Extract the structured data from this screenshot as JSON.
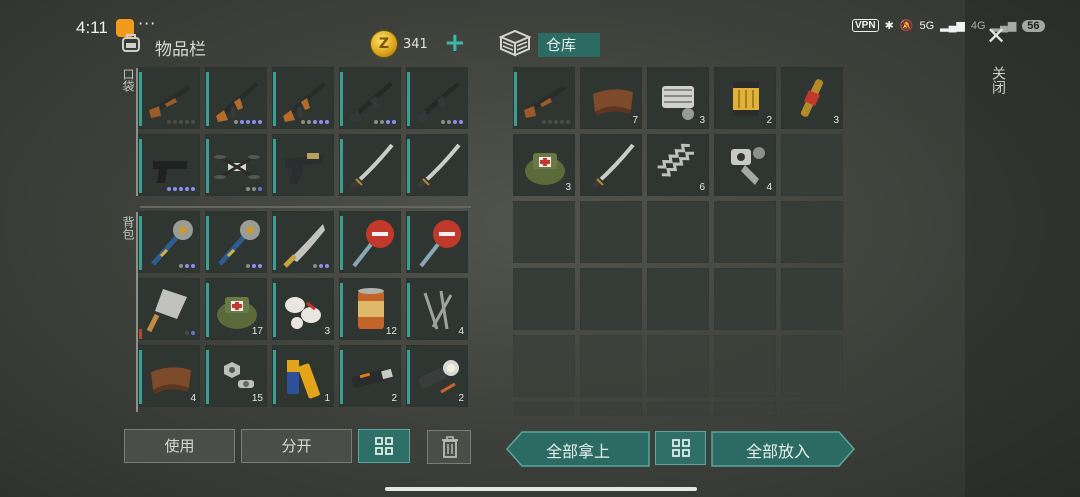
{
  "status_bar": {
    "time": "4:11",
    "dots": "···",
    "vpn": "VPN",
    "net1": "5G",
    "net2": "4G",
    "battery": "56"
  },
  "inventory": {
    "title": "物品栏",
    "coins": "341",
    "add": "+",
    "pocket_label": "口袋",
    "backpack_label": "背包"
  },
  "warehouse": {
    "title": "仓库"
  },
  "close": {
    "x": "✕",
    "label": "关闭"
  },
  "inventory_slots": [
    {
      "id": "inv-0",
      "item": "shotgun-icon",
      "qty": "",
      "dots": [
        "d",
        "d",
        "d",
        "d",
        "d"
      ]
    },
    {
      "id": "inv-1",
      "item": "ak-rifle-icon",
      "qty": "",
      "dots": [
        "g",
        "p",
        "p",
        "p",
        "p"
      ]
    },
    {
      "id": "inv-2",
      "item": "ak-rifle-icon",
      "qty": "",
      "dots": [
        "g",
        "g",
        "p",
        "p",
        "p"
      ]
    },
    {
      "id": "inv-3",
      "item": "assault-rifle-icon",
      "qty": "",
      "dots": [
        "g",
        "g",
        "p",
        "p"
      ]
    },
    {
      "id": "inv-4",
      "item": "assault-rifle-icon",
      "qty": "",
      "dots": [
        "g",
        "g",
        "p",
        "p"
      ]
    },
    {
      "id": "inv-5",
      "item": "pistol-icon",
      "qty": "",
      "dots": [
        "p",
        "p",
        "p",
        "p",
        "p"
      ]
    },
    {
      "id": "inv-6",
      "item": "drone-icon",
      "qty": "",
      "dots": [
        "g",
        "g",
        "b"
      ]
    },
    {
      "id": "inv-7",
      "item": "revolver-icon",
      "qty": "",
      "dots": []
    },
    {
      "id": "inv-8",
      "item": "katana-icon",
      "qty": "",
      "dots": []
    },
    {
      "id": "inv-9",
      "item": "katana-icon",
      "qty": "",
      "dots": []
    },
    {
      "id": "inv-10",
      "item": "spiked-club-icon",
      "qty": "",
      "dots": [
        "g",
        "p",
        "p"
      ]
    },
    {
      "id": "inv-11",
      "item": "spiked-club-icon",
      "qty": "",
      "dots": [
        "g",
        "p",
        "p"
      ]
    },
    {
      "id": "inv-12",
      "item": "machete-icon",
      "qty": "",
      "dots": [
        "g",
        "p",
        "p"
      ]
    },
    {
      "id": "inv-13",
      "item": "stop-sign-icon",
      "qty": "",
      "dots": []
    },
    {
      "id": "inv-14",
      "item": "stop-sign-icon",
      "qty": "",
      "dots": []
    },
    {
      "id": "inv-15",
      "item": "cleaver-icon",
      "qty": "",
      "dots": [
        "d",
        "b"
      ]
    },
    {
      "id": "inv-16",
      "item": "medkit-bag-icon",
      "qty": "17",
      "dots": []
    },
    {
      "id": "inv-17",
      "item": "bandage-icon",
      "qty": "3",
      "dots": []
    },
    {
      "id": "inv-18",
      "item": "food-can-icon",
      "qty": "12",
      "dots": []
    },
    {
      "id": "inv-19",
      "item": "nails-icon",
      "qty": "4",
      "dots": []
    },
    {
      "id": "inv-20",
      "item": "leather-icon",
      "qty": "4",
      "dots": []
    },
    {
      "id": "inv-21",
      "item": "nuts-bolts-icon",
      "qty": "15",
      "dots": []
    },
    {
      "id": "inv-22",
      "item": "batteries-icon",
      "qty": "1",
      "dots": []
    },
    {
      "id": "inv-23",
      "item": "usb-drive-icon",
      "qty": "2",
      "dots": []
    },
    {
      "id": "inv-24",
      "item": "flashlight-icon",
      "qty": "2",
      "dots": []
    }
  ],
  "warehouse_slots": [
    {
      "id": "wh-0",
      "item": "shotgun-icon",
      "qty": "",
      "dots": [
        "d",
        "d",
        "d",
        "d",
        "d"
      ]
    },
    {
      "id": "wh-1",
      "item": "leather-icon",
      "qty": "7",
      "dots": []
    },
    {
      "id": "wh-2",
      "item": "engine-part-icon",
      "qty": "3",
      "dots": []
    },
    {
      "id": "wh-3",
      "item": "oil-filter-icon",
      "qty": "2",
      "dots": []
    },
    {
      "id": "wh-4",
      "item": "spark-plug-icon",
      "qty": "3",
      "dots": []
    },
    {
      "id": "wh-5",
      "item": "medkit-bag-icon",
      "qty": "3",
      "dots": []
    },
    {
      "id": "wh-6",
      "item": "katana-icon",
      "qty": "",
      "dots": []
    },
    {
      "id": "wh-7",
      "item": "spring-icon",
      "qty": "6",
      "dots": []
    },
    {
      "id": "wh-8",
      "item": "mechanical-parts-icon",
      "qty": "4",
      "dots": []
    }
  ],
  "buttons": {
    "use": "使用",
    "split": "分开",
    "take_all": "全部拿上",
    "put_all": "全部放入"
  },
  "colors": {
    "accent_teal": "#2e6f68",
    "rarity_purple": "#8a8ff0",
    "coin_gold": "#d8a21c"
  }
}
